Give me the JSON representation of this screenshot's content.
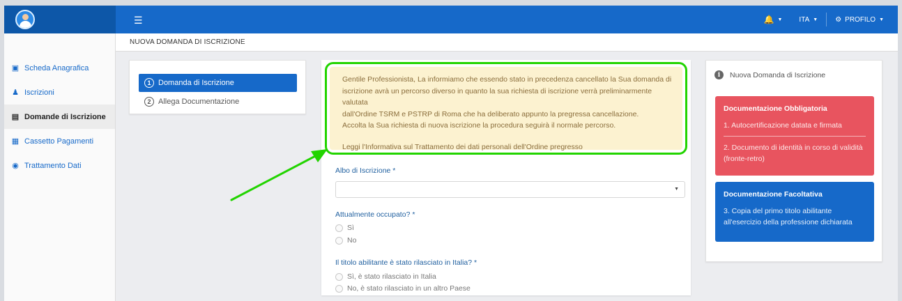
{
  "topbar": {
    "menu_icon": "hamburger-icon",
    "language": "ITA",
    "profile": "PROFILO",
    "colors": {
      "bar": "#1669c9",
      "logo_bg": "#0d57a8"
    }
  },
  "sidebar": {
    "items": [
      {
        "label": "Scheda Anagrafica",
        "icon": "id-card-icon"
      },
      {
        "label": "Iscrizioni",
        "icon": "user-icon"
      },
      {
        "label": "Domande di Iscrizione",
        "icon": "form-icon"
      },
      {
        "label": "Cassetto Pagamenti",
        "icon": "document-icon"
      },
      {
        "label": "Trattamento Dati",
        "icon": "eye-icon"
      }
    ]
  },
  "page": {
    "title": "NUOVA DOMANDA DI ISCRIZIONE"
  },
  "steps": [
    {
      "num": "1",
      "label": "Domanda di Iscrizione"
    },
    {
      "num": "2",
      "label": "Allega Documentazione"
    }
  ],
  "notice": {
    "line1": "Gentile Professionista, La informiamo che essendo stato in precedenza cancellato la Sua domanda di",
    "line2": "iscrizione avrà un percorso diverso in quanto la sua richiesta di iscrizione verrà preliminarmente valutata",
    "line3": "dall'Ordine TSRM e PSTRP di Roma che ha deliberato appunto la pregressa cancellazione.",
    "line4": "Accolta la Sua richiesta di nuova iscrizione la procedura seguirà il normale percorso.",
    "link": "Leggi l'Informativa sul Trattamento dei dati personali dell'Ordine pregresso",
    "highlight_color": "#22d400"
  },
  "form": {
    "albo_label": "Albo di Iscrizione *",
    "albo_value": "",
    "occupato_label": "Attualmente occupato? *",
    "occupato_options": [
      "Sì",
      "No"
    ],
    "titolo_label": "Il titolo abilitante è stato rilasciato in Italia? *",
    "titolo_options": [
      "Sì, è stato rilasciato in Italia",
      "No, è stato rilasciato in un altro Paese"
    ]
  },
  "info": {
    "title": "Nuova Domanda di Iscrizione",
    "obbligatoria": {
      "title": "Documentazione Obbligatoria",
      "item1": "1. Autocertificazione datata e firmata",
      "item2a": "2. Documento di identità in corso di validità",
      "item2b": "(fronte-retro)",
      "color": "#e8545f"
    },
    "facoltativa": {
      "title": "Documentazione Facoltativa",
      "item1a": "3. Copia del primo titolo abilitante",
      "item1b": "all'esercizio della professione dichiarata",
      "color": "#1669c9"
    }
  }
}
